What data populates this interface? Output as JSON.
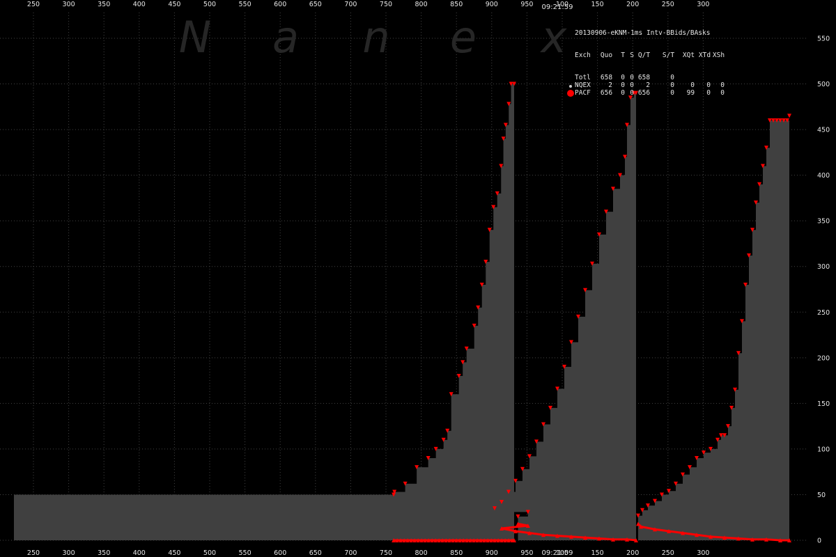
{
  "chart_data": {
    "type": "area",
    "title": "20130906-eKNM-1ms Intv-BBids/BAsks",
    "top_time_label": "09:21:59",
    "bottom_time_label": "09:21:59",
    "watermark_letters": [
      "N",
      "a",
      "n",
      "e",
      "x"
    ],
    "ylim": [
      0,
      550
    ],
    "y_ticks": [
      0,
      50,
      100,
      150,
      200,
      250,
      300,
      350,
      400,
      450,
      500,
      550
    ],
    "x_tick_labels_top": [
      "250",
      "300",
      "350",
      "400",
      "450",
      "500",
      "550",
      "600",
      "650",
      "700",
      "750",
      "800",
      "850",
      "900",
      "950",
      "100",
      "150",
      "200",
      "250",
      "300"
    ],
    "x_tick_labels_bottom": [
      "250",
      "300",
      "350",
      "400",
      "450",
      "500",
      "550",
      "600",
      "650",
      "700",
      "750",
      "800",
      "850",
      "900",
      "950",
      "09:21:59",
      "100",
      "150",
      "200",
      "250",
      "300"
    ],
    "grid": true,
    "colors": {
      "background": "#000000",
      "area": "#404040",
      "marker": "#ff0000",
      "grid": "#444444",
      "text": "#e6e6e6"
    },
    "series": [
      {
        "name": "BAsks",
        "segments": [
          {
            "x": [
              230,
              725,
              726,
              740,
              755,
              770,
              780,
              790,
              795,
              800,
              810,
              815,
              820,
              830,
              835,
              840,
              845,
              850,
              855,
              860,
              865,
              868,
              871,
              875,
              878,
              882
            ],
            "values": [
              50,
              50,
              53,
              62,
              80,
              90,
              100,
              110,
              120,
              160,
              180,
              195,
              210,
              235,
              255,
              280,
              305,
              340,
              365,
              380,
              410,
              440,
              455,
              478,
              500,
              500
            ]
          },
          {
            "x": [
              887,
              900,
              910,
              920,
              930,
              940,
              950,
              960,
              970,
              980,
              990,
              1000,
              1010,
              1020,
              1030,
              1040,
              1050,
              1060,
              1070,
              1080,
              1090,
              1097,
              1100,
              1105,
              1110,
              1113
            ],
            "values": [
              26,
              31,
              35,
              42,
              53,
              65,
              78,
              92,
              108,
              127,
              145,
              166,
              190,
              217,
              245,
              274,
              303,
              335,
              360,
              385,
              400,
              420,
              455,
              485,
              490,
              490
            ]
          },
          {
            "x": [
              1116,
              1122,
              1130,
              1140,
              1150,
              1160,
              1170,
              1180,
              1190,
              1200,
              1210,
              1220,
              1230,
              1235,
              1240,
              1245,
              1250,
              1255,
              1260,
              1265,
              1270,
              1275,
              1280,
              1285,
              1290,
              1295,
              1300,
              1305,
              1310,
              1315,
              1320,
              1325,
              1330,
              1333
            ],
            "values": [
              27,
              33,
              38,
              43,
              50,
              54,
              62,
              72,
              80,
              90,
              96,
              100,
              110,
              115,
              115,
              125,
              145,
              165,
              205,
              240,
              280,
              312,
              340,
              370,
              390,
              410,
              430,
              460,
              460,
              460,
              460,
              460,
              460,
              465
            ]
          }
        ]
      },
      {
        "name": "BBids",
        "segments": [
          {
            "x": [
              725,
              882
            ],
            "values": [
              0,
              0
            ]
          },
          {
            "x": [
              887,
              900,
              920,
              940,
              960,
              980,
              1000,
              1020,
              1040,
              1060,
              1080,
              1100,
              1113
            ],
            "values": [
              18,
              16,
              13,
              10,
              8,
              6,
              5,
              4,
              3,
              2,
              1,
              1,
              0
            ]
          },
          {
            "x": [
              1116,
              1120,
              1140,
              1160,
              1180,
              1200,
              1220,
              1240,
              1260,
              1280,
              1300,
              1320,
              1333
            ],
            "values": [
              18,
              15,
              12,
              10,
              8,
              6,
              4,
              3,
              2,
              1,
              1,
              0,
              0
            ]
          }
        ]
      }
    ]
  },
  "legend": {
    "header": [
      "Exch",
      "Quo",
      "T",
      "S",
      "Q/T",
      "S/T",
      "XQt",
      "XTd",
      "XSh"
    ],
    "rows": [
      {
        "cells": [
          "Totl",
          "658",
          "0",
          "0",
          "658",
          "0",
          "",
          "",
          ""
        ],
        "marker": "none"
      },
      {
        "cells": [
          "NQEX",
          "2",
          "0",
          "0",
          "2",
          "0",
          "0",
          "0",
          "0"
        ],
        "marker": "#cccccc"
      },
      {
        "cells": [
          "PACF",
          "656",
          "0",
          "0",
          "656",
          "0",
          "99",
          "0",
          "0"
        ],
        "marker": "#ff0000"
      }
    ]
  }
}
